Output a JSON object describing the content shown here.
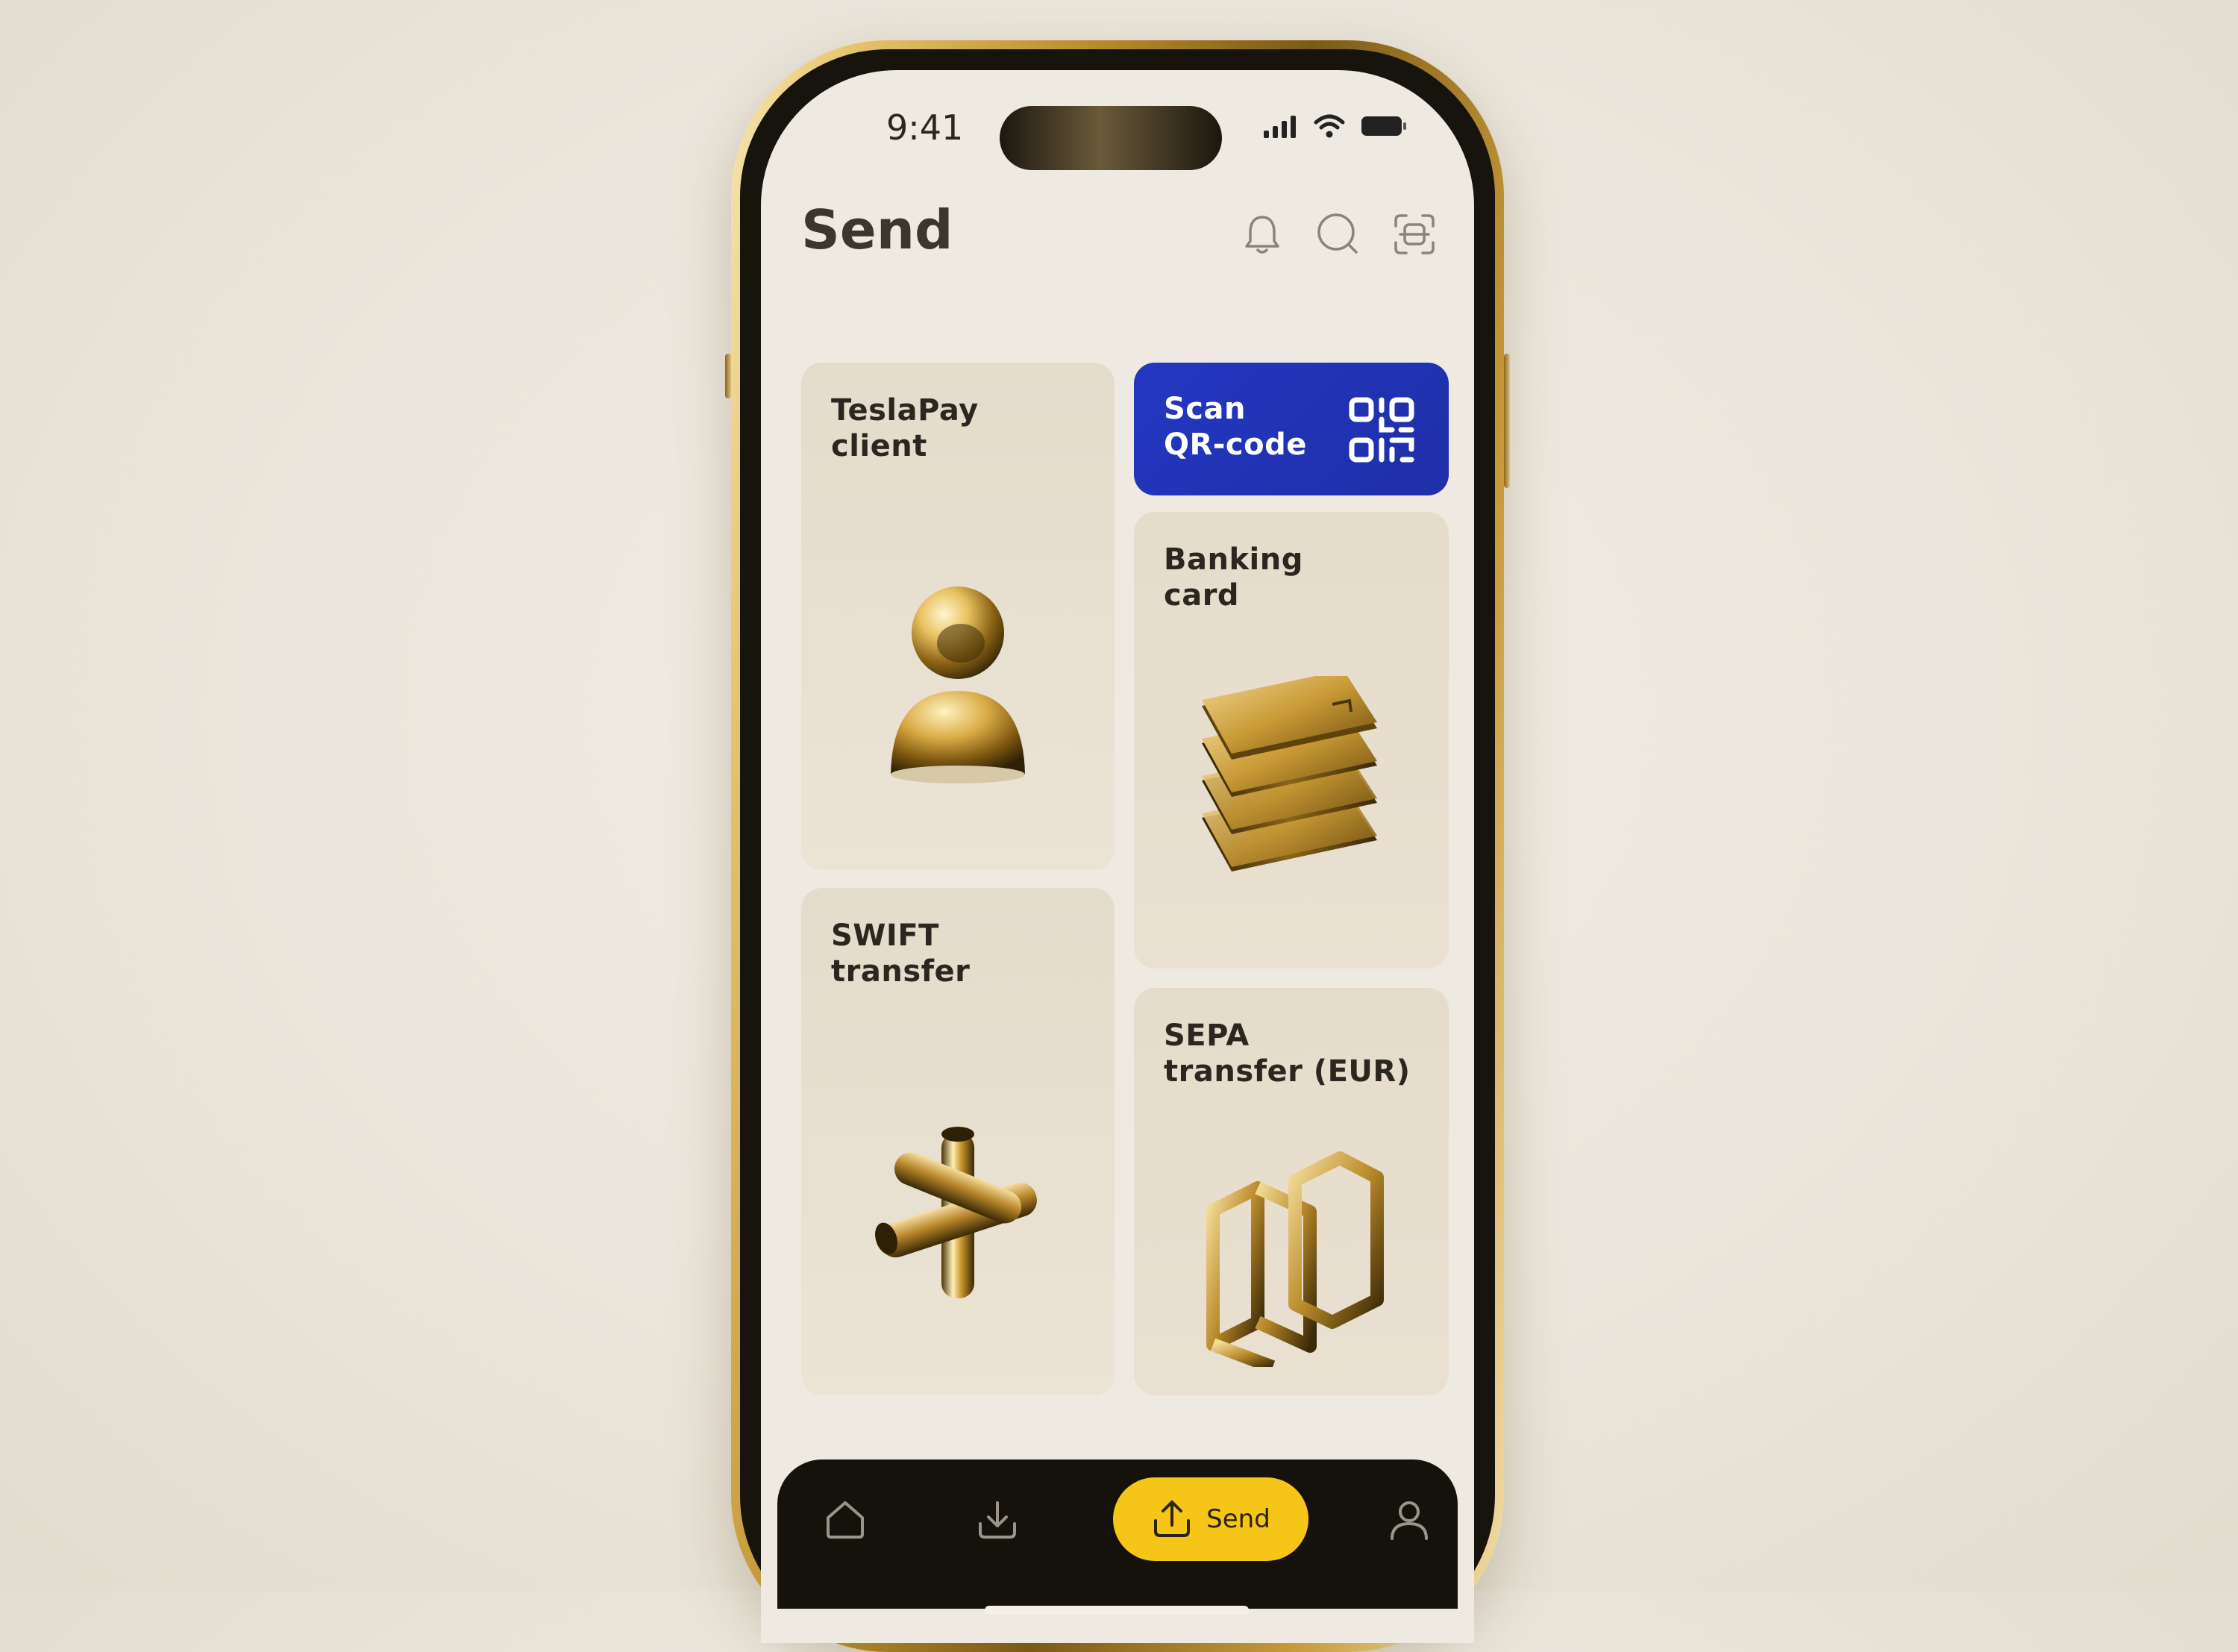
{
  "status_bar": {
    "time": "9:41"
  },
  "header": {
    "title": "Send",
    "icons": [
      "bell-icon",
      "search-icon",
      "scan-icon"
    ]
  },
  "cards": {
    "teslapay": {
      "label": "TeslaPay\nclient",
      "art": "user-icon"
    },
    "scan_qr": {
      "label": "Scan\nQR-code",
      "art": "qr-code-icon",
      "color": "#2236bf"
    },
    "banking_card": {
      "label": "Banking\ncard",
      "art": "card-stack-icon"
    },
    "swift": {
      "label": "SWIFT\ntransfer",
      "art": "cross-pipe-icon"
    },
    "sepa": {
      "label": "SEPA\ntransfer (EUR)",
      "art": "cube-frame-icon"
    }
  },
  "bottom_nav": {
    "items": [
      "home-icon",
      "receive-icon",
      "send-icon",
      "profile-icon"
    ],
    "active_label": "Send",
    "active_color": "#f5c518"
  },
  "colors": {
    "accent": "#f5c518",
    "gold": "#c79a3a",
    "background": "#efeae1"
  }
}
